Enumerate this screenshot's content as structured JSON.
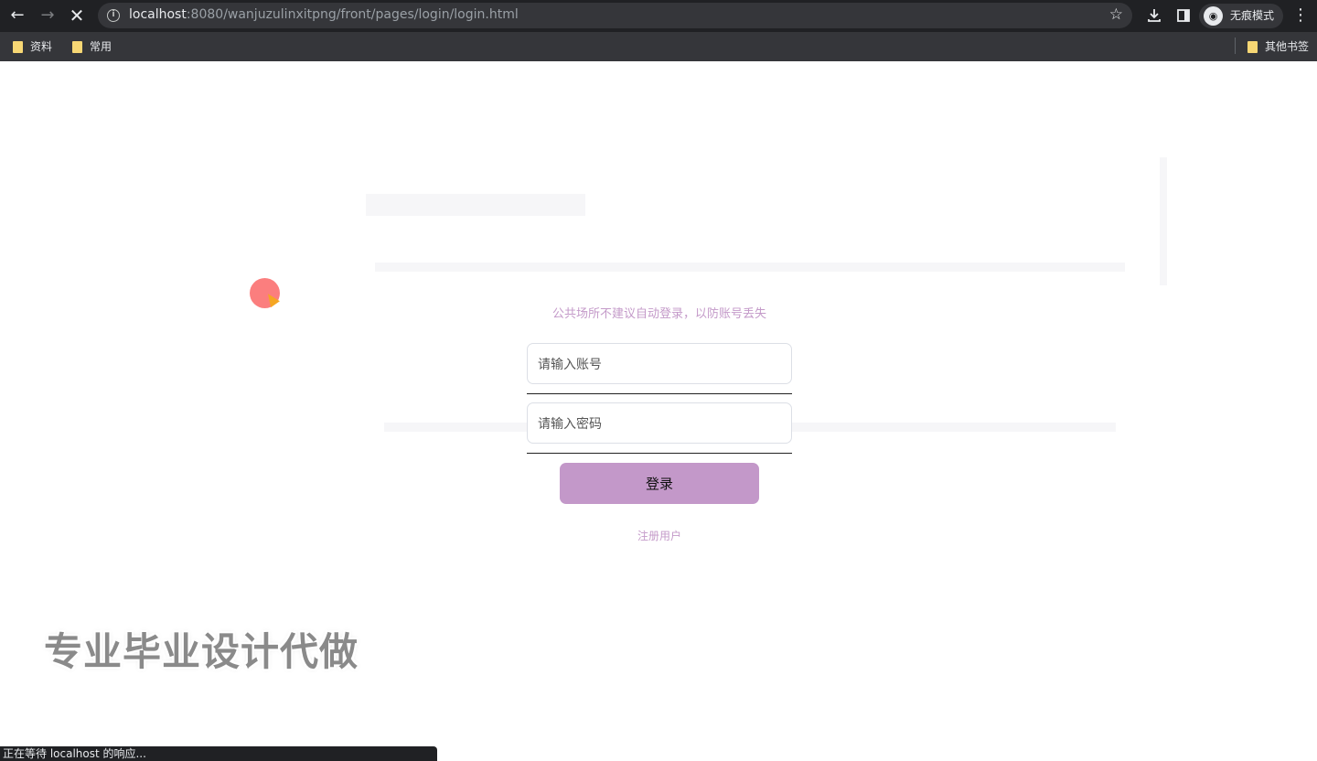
{
  "browser": {
    "url_host": "localhost",
    "url_rest": ":8080/wanjuzulinxitpng/front/pages/login/login.html",
    "incognito_label": "无痕模式",
    "bookmarks": [
      {
        "label": "资料"
      },
      {
        "label": "常用"
      }
    ],
    "other_bookmarks_label": "其他书签",
    "status_text": "正在等待 localhost 的响应..."
  },
  "login": {
    "tip": "公共场所不建议自动登录，以防账号丢失",
    "account_placeholder": "请输入账号",
    "password_placeholder": "请输入密码",
    "login_button": "登录",
    "register_link": "注册用户"
  },
  "overlay": {
    "watermark": "专业毕业设计代做"
  },
  "colors": {
    "accent": "#c398c9",
    "tip_text": "#c49ac9",
    "chrome_dark": "#202124",
    "chrome_bar": "#35363a"
  },
  "icons": [
    "back-arrow-icon",
    "forward-arrow-icon",
    "stop-icon",
    "info-icon",
    "star-icon",
    "download-icon",
    "side-panel-icon",
    "incognito-icon",
    "more-menu-icon",
    "folder-icon"
  ]
}
